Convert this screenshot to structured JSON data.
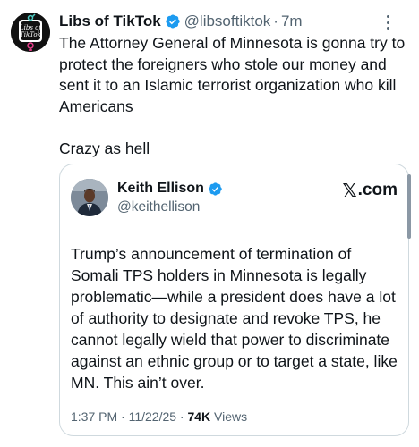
{
  "tweet": {
    "author_name": "Libs of TikTok",
    "handle": "@libsoftiktok",
    "separator": "·",
    "time": "7m",
    "avatar_label": "Libs of TikTok",
    "avatar_line1": "Libs of",
    "avatar_line2": "TikTok",
    "body_paragraphs": [
      "The Attorney General of Minnesota is gonna try to protect the foreigners who stole our money and sent it to an Islamic terrorist organization who kill Americans",
      "Crazy as hell"
    ]
  },
  "quote": {
    "author_name": "Keith Ellison",
    "handle": "@keithellison",
    "source": ".com",
    "source_logo": "𝕏",
    "body_lines": [
      "Trump’s announcement of termination of",
      "Somali TPS holders in Minnesota is legally",
      "problematic—while a president does have a lot",
      "of authority to designate and revoke TPS, he",
      "cannot legally wield that power to discriminate",
      "against an ethnic group or to target a state, like",
      "MN. This ain’t over."
    ],
    "timestamp": "1:37 PM · 11/22/25 · ",
    "views_count": "74K",
    "views_label": " Views"
  },
  "colors": {
    "verified_badge": "#1d9bf0",
    "secondary_text": "#536471",
    "border": "#cfd9de",
    "avatar_pink": "#e83e8c"
  },
  "icons": {
    "verified": "verified-badge-icon",
    "more": "more-options-icon",
    "x_logo": "x-logo-icon"
  }
}
